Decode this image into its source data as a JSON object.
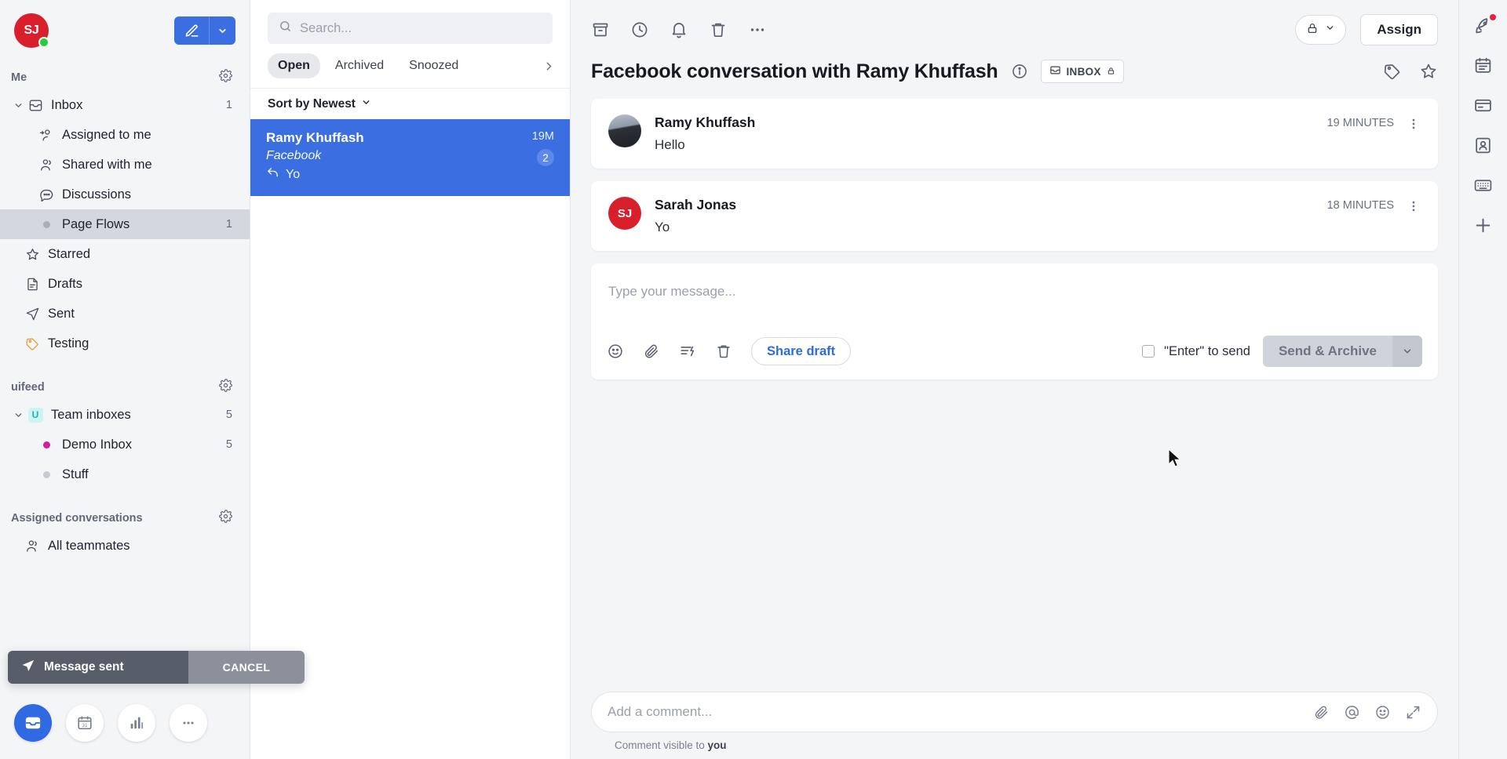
{
  "sidebar": {
    "account": {
      "initials": "SJ",
      "presence": "online"
    },
    "compose_label": "compose-icon",
    "sections": [
      {
        "title": "Me",
        "has_settings": true,
        "items": [
          {
            "label": "Inbox",
            "icon": "inbox-icon",
            "count": "1",
            "level": 0,
            "expandable": true
          },
          {
            "label": "Assigned to me",
            "icon": "assigned-person-icon",
            "count": "",
            "level": 1
          },
          {
            "label": "Shared with me",
            "icon": "people-icon",
            "count": "",
            "level": 1
          },
          {
            "label": "Discussions",
            "icon": "chat-bubble-icon",
            "count": "",
            "level": 1
          },
          {
            "label": "Page Flows",
            "icon": "dot-icon",
            "count": "1",
            "level": 1,
            "active": true,
            "dot_color": "#a9aeb8"
          },
          {
            "label": "Starred",
            "icon": "star-icon",
            "count": "",
            "level": 0
          },
          {
            "label": "Drafts",
            "icon": "draft-icon",
            "count": "",
            "level": 0
          },
          {
            "label": "Sent",
            "icon": "send-icon",
            "count": "",
            "level": 0
          },
          {
            "label": "Testing",
            "icon": "tag-icon",
            "count": "",
            "level": 0,
            "icon_color": "#e9a23b"
          }
        ]
      },
      {
        "title": "uifeed",
        "has_settings": true,
        "items": [
          {
            "label": "Team inboxes",
            "icon": "team-logo-icon",
            "count": "5",
            "level": 0,
            "expandable": true,
            "team_initial": "U"
          },
          {
            "label": "Demo Inbox",
            "icon": "dot-icon",
            "count": "5",
            "level": 1,
            "dot_color": "#d81b9c"
          },
          {
            "label": "Stuff",
            "icon": "dot-icon",
            "count": "",
            "level": 1,
            "dot_color": "#c6cad1"
          }
        ]
      },
      {
        "title": "Assigned conversations",
        "has_settings": true,
        "items": [
          {
            "label": "All teammates",
            "icon": "people-icon",
            "count": "",
            "level": 0
          }
        ]
      }
    ],
    "toast": {
      "message": "Message sent",
      "cancel_label": "CANCEL",
      "icon": "send-icon"
    },
    "dock": [
      {
        "name": "inbox-icon",
        "selected": true
      },
      {
        "name": "calendar-icon",
        "selected": false
      },
      {
        "name": "analytics-icon",
        "selected": false
      },
      {
        "name": "more-icon",
        "selected": false
      }
    ]
  },
  "conversation_list": {
    "search": {
      "placeholder": "Search...",
      "value": "",
      "icon": "search-icon"
    },
    "tabs": [
      {
        "label": "Open",
        "active": true
      },
      {
        "label": "Archived",
        "active": false
      },
      {
        "label": "Snoozed",
        "active": false
      }
    ],
    "overflow_icon": "chevron-right-icon",
    "sort_label": "Sort by Newest",
    "items": [
      {
        "name": "Ramy Khuffash",
        "channel": "Facebook",
        "snippet": "Yo",
        "snippet_icon": "reply-icon",
        "time": "19M",
        "unread_count": "2",
        "selected": true
      }
    ]
  },
  "main": {
    "toolbar_icons": [
      "archive-icon",
      "snooze-clock-icon",
      "bell-icon",
      "trash-icon",
      "more-horizontal-icon"
    ],
    "lock_button": {
      "icon": "lock-icon",
      "caret": "chevron-down-icon"
    },
    "assign_label": "Assign",
    "title": "Facebook conversation with Ramy Khuffash",
    "info_icon": "info-icon",
    "inbox_chip": {
      "label": "INBOX",
      "icon": "inbox-icon",
      "lock": "lock-icon"
    },
    "header_right_icons": [
      "tag-icon",
      "star-icon"
    ],
    "messages": [
      {
        "author": "Ramy Khuffash",
        "text": "Hello",
        "time": "19 MINUTES",
        "avatar_type": "photo",
        "initials": ""
      },
      {
        "author": "Sarah Jonas",
        "text": "Yo",
        "time": "18 MINUTES",
        "avatar_type": "initials",
        "initials": "SJ"
      }
    ],
    "composer": {
      "placeholder": "Type your message...",
      "value": "",
      "icons": [
        "emoji-icon",
        "attachment-icon",
        "canned-response-icon",
        "trash-icon"
      ],
      "share_draft_label": "Share draft",
      "enter_to_send_label": "\"Enter\" to send",
      "enter_to_send_checked": false,
      "send_label": "Send & Archive",
      "send_caret": "chevron-down-icon"
    },
    "comment": {
      "placeholder": "Add a comment...",
      "value": "",
      "icons": [
        "attachment-icon",
        "mention-icon",
        "emoji-icon",
        "expand-icon"
      ],
      "visibility_prefix": "Comment visible to ",
      "visibility_target": "you"
    }
  },
  "rail": {
    "items": [
      {
        "name": "rocket-icon",
        "has_dot": true
      },
      {
        "name": "calendar-day-icon",
        "has_dot": false
      },
      {
        "name": "card-icon",
        "has_dot": false
      },
      {
        "name": "contact-icon",
        "has_dot": false
      },
      {
        "name": "keyboard-icon",
        "has_dot": false
      },
      {
        "name": "plus-icon",
        "has_dot": false
      }
    ]
  },
  "colors": {
    "accent": "#3b6ee0",
    "selected_row": "#3b6ee0",
    "danger": "#d91f2b",
    "online": "#27c93f"
  }
}
